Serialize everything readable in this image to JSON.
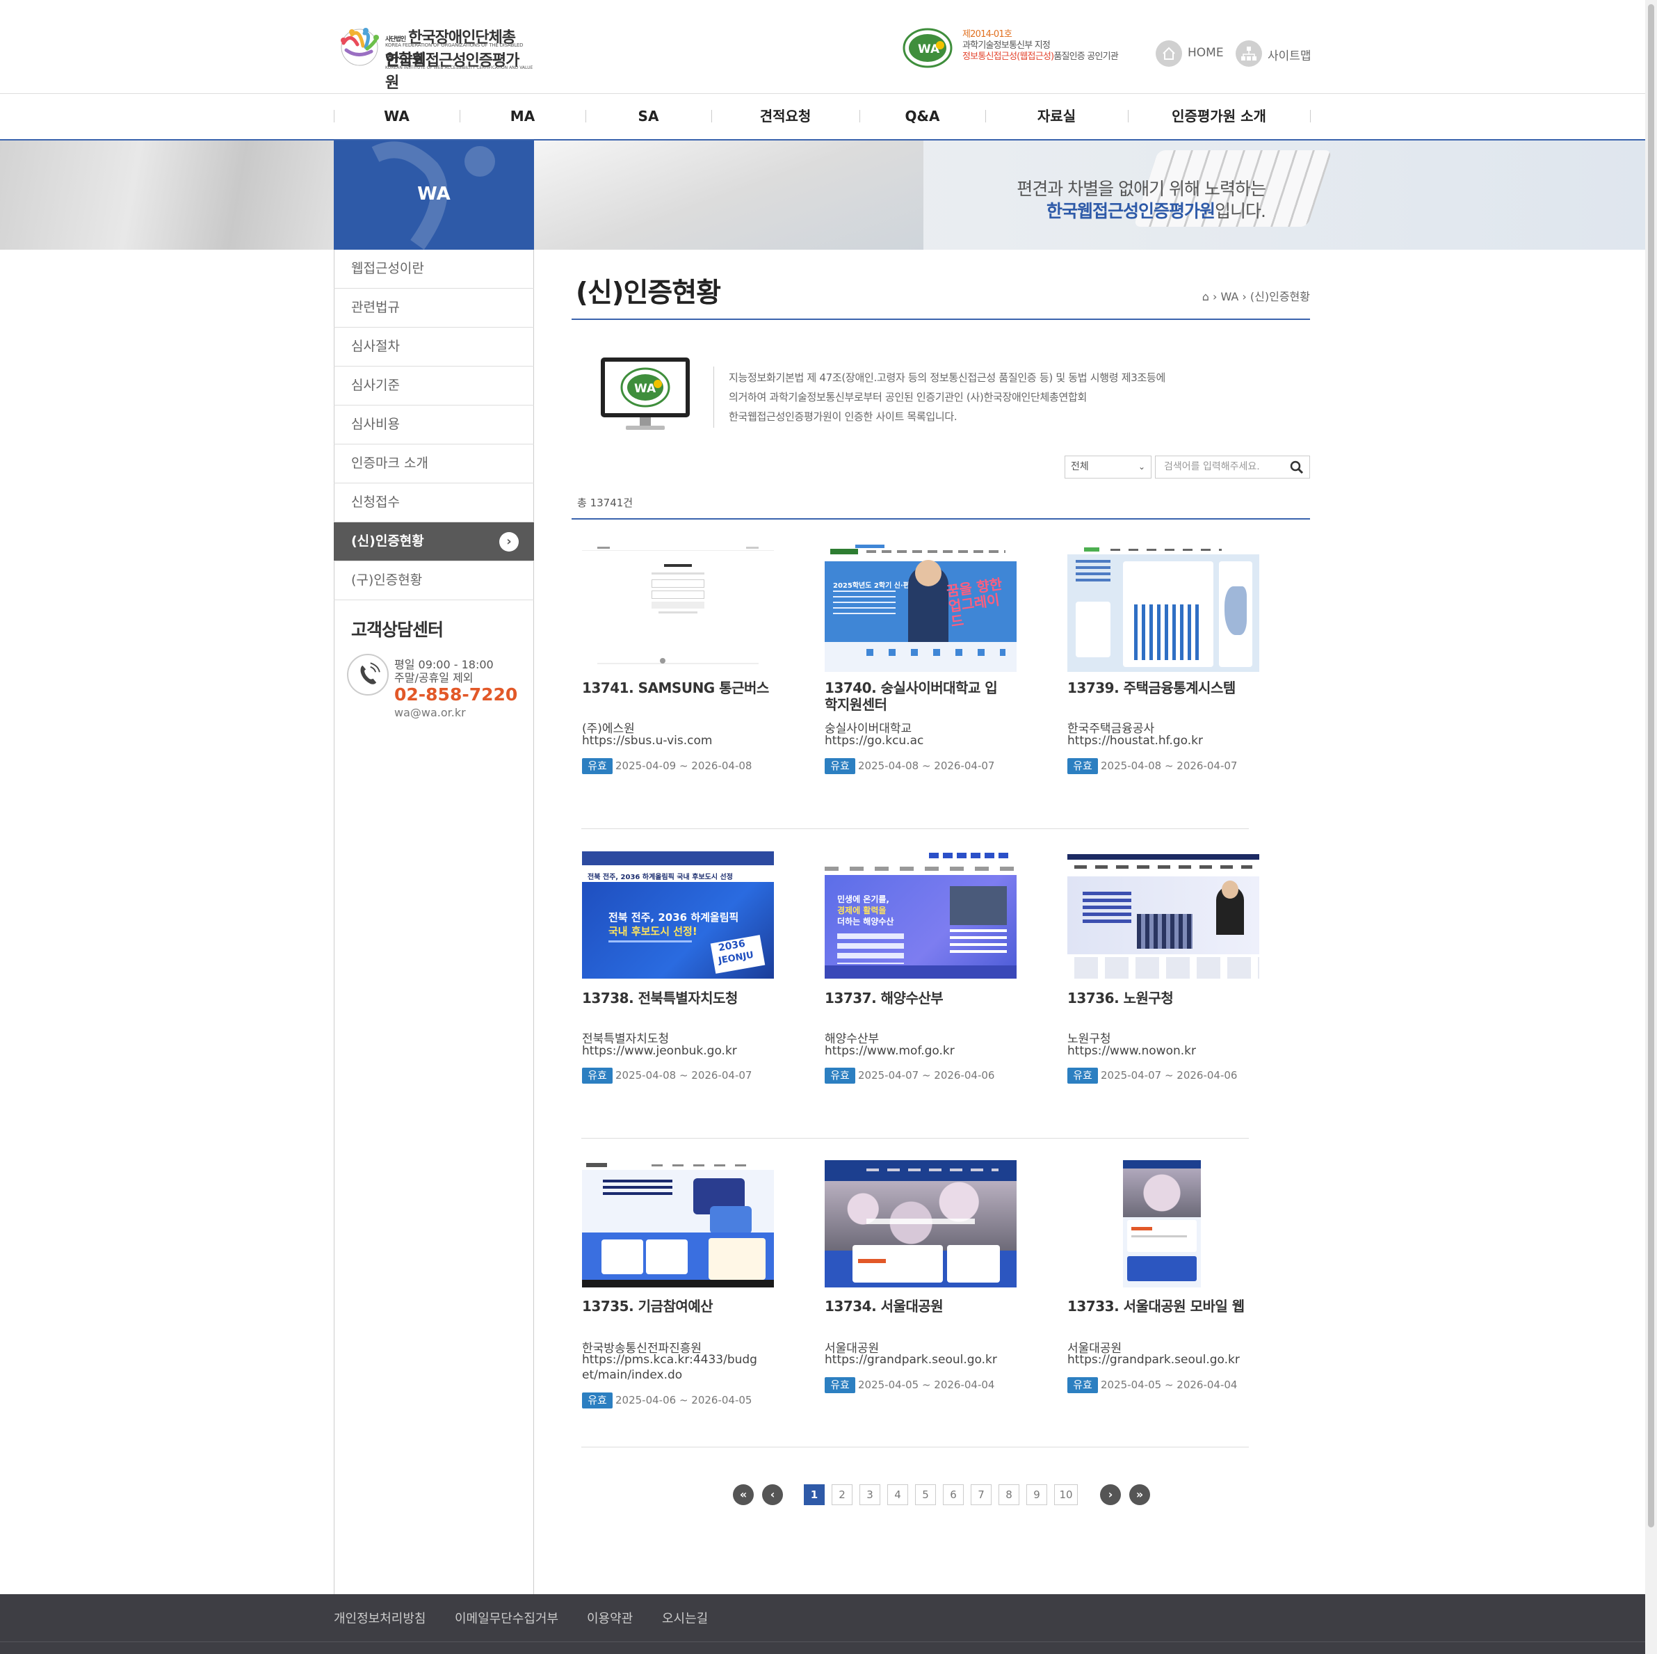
{
  "header": {
    "logo": {
      "org_small": "사단법인",
      "org_name": "한국장애인단체총연합회",
      "org_english": "KOREA FEDERATION OF ORGANIZATIONS OF THE DISABLED",
      "institute_name": "한국웹접근성인증평가원",
      "institute_english": "KOREAN INSTITUTE OF WEB ACCESSIBILITY CERTIFICATION AND VALUE"
    },
    "certification": {
      "line1": "제2014-01호",
      "line2": "과학기술정보통신부 지정",
      "line3_highlight": "정보통신접근성(웹접근성)",
      "line3_rest": "품질인증 공인기관"
    },
    "home_label": "HOME",
    "sitemap_label": "사이트맵"
  },
  "gnb": [
    "WA",
    "MA",
    "SA",
    "견적요청",
    "Q&A",
    "자료실",
    "인증평가원 소개"
  ],
  "visual": {
    "section_label": "WA",
    "copy_line1": "편견과 차별을 없애기 위해 노력하는",
    "copy_line2_bold": "한국웹접근성인증평가원",
    "copy_line2_rest": "입니다."
  },
  "lnb": {
    "items": [
      "웹접근성이란",
      "관련법규",
      "심사절차",
      "심사기준",
      "심사비용",
      "인증마크 소개",
      "신청접수",
      "(신)인증현황",
      "(구)인증현황"
    ],
    "active_index": 7
  },
  "customer_center": {
    "title": "고객상담센터",
    "hours_weekday": "평일 09:00 - 18:00",
    "hours_holiday": "주말/공휴일 제외",
    "phone": "02-858-7220",
    "email": "wa@wa.or.kr"
  },
  "page": {
    "title": "(신)인증현황",
    "breadcrumb": [
      "WA",
      "(신)인증현황"
    ],
    "intro": [
      "지능정보화기본법 제 47조(장애인.고령자 등의 정보통신접근성 품질인증 등) 및 동법 시행령 제3조등에",
      "의거하여 과학기술정보통신부로부터 공인된 인증기관인 (사)한국장애인단체총연합회",
      "한국웹접근성인증평가원이 인증한 사이트 목록입니다."
    ],
    "search": {
      "select_value": "전체",
      "placeholder": "검색어를 입력해주세요."
    },
    "total": "총 13741건"
  },
  "cards": [
    {
      "title": "13741. SAMSUNG 통근버스",
      "org": "(주)에스원",
      "url": "https://sbus.u-vis.com",
      "status": "유효",
      "period": "2025-04-09 ~ 2026-04-08",
      "thumb": "samsung-login"
    },
    {
      "title": "13740. 숭실사이버대학교 입학지원센터",
      "org": "숭실사이버대학교",
      "url": "https://go.kcu.ac",
      "status": "유효",
      "period": "2025-04-08 ~ 2026-04-07",
      "thumb": "kcu-banner",
      "thumb_text_1": "2025학년도 2학기 신·편입생 모집",
      "thumb_text_2": "꿈을 향한 업그레이드"
    },
    {
      "title": "13739. 주택금융통계시스템",
      "org": "한국주택금융공사",
      "url": "https://houstat.hf.go.kr",
      "status": "유효",
      "period": "2025-04-08 ~ 2026-04-07",
      "thumb": "hf-chart"
    },
    {
      "title": "13738. 전북특별자치도청",
      "org": "전북특별자치도청",
      "url": "https://www.jeonbuk.go.kr",
      "status": "유효",
      "period": "2025-04-08 ~ 2026-04-07",
      "thumb": "jeonbuk",
      "thumb_text_1": "전북 전주, 2036 하계올림픽 국내 후보도시 선정",
      "thumb_text_2": "전북 전주, 2036 하계올림픽",
      "thumb_text_3": "국내 후보도시 선정!",
      "thumb_text_4": "2036",
      "thumb_text_5": "JEONJU"
    },
    {
      "title": "13737. 해양수산부",
      "org": "해양수산부",
      "url": "https://www.mof.go.kr",
      "status": "유효",
      "period": "2025-04-07 ~ 2026-04-06",
      "thumb": "mof",
      "thumb_text_1": "민생에 온기를,",
      "thumb_text_2": "경제에 활력을",
      "thumb_text_3": "더하는 해양수산"
    },
    {
      "title": "13736. 노원구청",
      "org": "노원구청",
      "url": "https://www.nowon.kr",
      "status": "유효",
      "period": "2025-04-07 ~ 2026-04-06",
      "thumb": "nowon"
    },
    {
      "title": "13735. 기금참여예산",
      "org": "한국방송통신전파진흥원",
      "url": "https://pms.kca.kr:4433/budget/main/index.do",
      "status": "유효",
      "period": "2025-04-06 ~ 2026-04-05",
      "thumb": "kca"
    },
    {
      "title": "13734. 서울대공원",
      "org": "서울대공원",
      "url": "https://grandpark.seoul.go.kr",
      "status": "유효",
      "period": "2025-04-05 ~ 2026-04-04",
      "thumb": "grandpark"
    },
    {
      "title": "13733. 서울대공원 모바일 웹",
      "org": "서울대공원",
      "url": "https://grandpark.seoul.go.kr",
      "status": "유효",
      "period": "2025-04-05 ~ 2026-04-04",
      "thumb": "grandpark-mobile"
    }
  ],
  "pagination": {
    "pages": [
      "1",
      "2",
      "3",
      "4",
      "5",
      "6",
      "7",
      "8",
      "9",
      "10"
    ],
    "current": "1",
    "first_icon": "double-chevron-left",
    "prev_icon": "chevron-left",
    "next_icon": "chevron-right",
    "last_icon": "double-chevron-right"
  },
  "footer": {
    "links": [
      "개인정보처리방침",
      "이메일무단수집거부",
      "이용약관",
      "오시는길"
    ]
  },
  "colors": {
    "brand_blue": "#2e5aa8",
    "badge_blue": "#2c7fc1",
    "phone_orange": "#e25828",
    "footer_bg": "#3e3e44"
  }
}
